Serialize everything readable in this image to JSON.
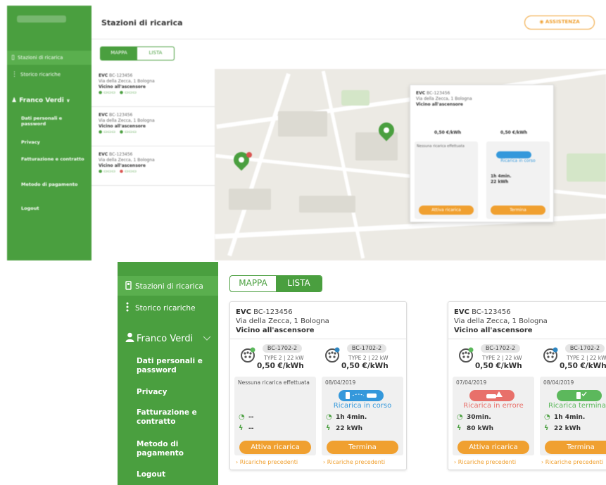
{
  "top_panel": {
    "page_title": "Stazioni di ricarica",
    "assist_label": "ASSISTENZA",
    "tabs": [
      "MAPPA",
      "LISTA"
    ],
    "sidebar": {
      "items": [
        "Stazioni di ricarica",
        "Storico ricariche"
      ],
      "user": "Franco Verdi",
      "subitems": [
        "Dati personali e password",
        "Privacy",
        "Fatturazione e contratto",
        "Metodo di pagamento",
        "Logout"
      ]
    },
    "list": [
      {
        "evc": "EVC",
        "code": "BC-123456",
        "address": "Via della Zecca, 1 Bologna",
        "note": "Vicino all'ascensore"
      },
      {
        "evc": "EVC",
        "code": "BC-123456",
        "address": "Via della Zecca, 1 Bologna",
        "note": "Vicino all'ascensore"
      },
      {
        "evc": "EVC",
        "code": "BC-123456",
        "address": "Via della Zecca, 1 Bologna",
        "note": "Vicino all'ascensore"
      }
    ],
    "popup": {
      "evc": "EVC",
      "code": "BC-123456",
      "address": "Via della Zecca, 1 Bologna",
      "note": "Vicino all'ascensore",
      "price": "0,50 €/kWh",
      "msg": "Nessuna ricarica effettuata",
      "status": "Ricarica in corso",
      "time": "1h 4min.",
      "energy": "22 kWh",
      "btn_start": "Attiva ricarica",
      "btn_end": "Termina",
      "prev": "Ricariche precedenti"
    }
  },
  "sidebar": {
    "items": [
      {
        "label": "Stazioni di ricarica",
        "icon": "charging-station-icon"
      },
      {
        "label": "Storico ricariche",
        "icon": "history-icon"
      }
    ],
    "user": "Franco Verdi",
    "subitems": [
      "Dati personali e password",
      "Privacy",
      "Fatturazione e contratto",
      "Metodo di pagamento",
      "Logout"
    ]
  },
  "tabs": [
    "MAPPA",
    "LISTA"
  ],
  "cards": [
    {
      "evc": "EVC",
      "code": "BC-123456",
      "address": "Via della Zecca, 1 Bologna",
      "note": "Vicino all'ascensore",
      "connectors": [
        {
          "code": "BC-1702-2",
          "type": "TYPE 2 | 22 kW",
          "price": "0,50 €/kWh",
          "dot": "#5cb85c",
          "date": "",
          "message": "Nessuna ricarica effettuata",
          "status": "",
          "time": "--",
          "energy": "--",
          "button": "Attiva ricarica",
          "prev": "Ricariche precedenti"
        },
        {
          "code": "BC-1702-2",
          "type": "TYPE 2 | 22 kW",
          "price": "0,50 €/kWh",
          "dot": "#2e86c1",
          "date": "08/04/2019",
          "message": "",
          "status": "Ricarica in corso",
          "time": "1h 4min.",
          "energy": "22 kWh",
          "button": "Termina",
          "prev": "Ricariche precedenti"
        }
      ]
    },
    {
      "evc": "EVC",
      "code": "BC-123456",
      "address": "Via della Zecca, 1 Bologna",
      "note": "Vicino all'ascensore",
      "connectors": [
        {
          "code": "BC-1702-2",
          "type": "TYPE 2 | 22 kW",
          "price": "0,50 €/kWh",
          "dot": "#5cb85c",
          "date": "07/04/2019",
          "message": "",
          "status": "Ricarica in errore",
          "time": "30min.",
          "energy": "80 kWh",
          "button": "Attiva ricarica",
          "prev": "Ricariche precedenti"
        },
        {
          "code": "BC-1702-2",
          "type": "TYPE 2 | 22 kW",
          "price": "0,50 €/kWh",
          "dot": "#2e86c1",
          "date": "08/04/2019",
          "message": "",
          "status": "Ricarica terminata",
          "time": "1h 4min.",
          "energy": "22 kWh",
          "button": "Termina",
          "prev": "Ricariche precedenti"
        }
      ]
    }
  ],
  "colors": {
    "brand_green": "#4a9f3f",
    "accent_orange": "#f0a030",
    "status_blue": "#3498db",
    "status_red": "#e8706a",
    "status_green": "#5cb85c"
  }
}
